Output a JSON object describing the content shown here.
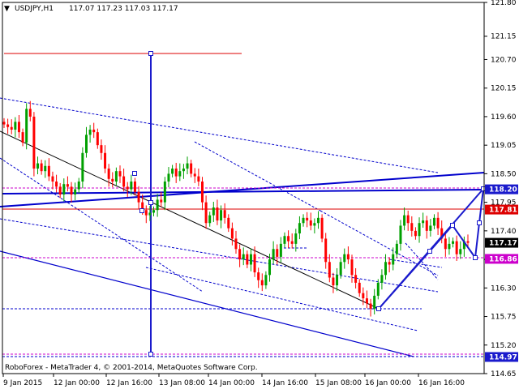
{
  "header": {
    "arrow": "▼",
    "symbol": "USDJPY,H1",
    "ohlc": "117.07 117.23 117.03 117.17"
  },
  "footer": {
    "copyright": "RoboForex - MetaTrader 4, © 2001-2014, MetaQuotes Software Corp."
  },
  "colors": {
    "bull": "#00a000",
    "bear": "#ff0000",
    "trendline": "#0000cc",
    "level_red": "#dd0000",
    "level_magenta": "#cc00cc",
    "projection": "#1a1acc",
    "axis": "#000000"
  },
  "chart_data": {
    "type": "candlestick",
    "symbol": "USDJPY",
    "timeframe": "H1",
    "ylim": [
      114.65,
      121.8
    ],
    "yticks": [
      "121.80",
      "121.15",
      "120.70",
      "120.15",
      "119.60",
      "119.05",
      "118.50",
      "117.95",
      "117.40",
      "116.85",
      "116.30",
      "115.75",
      "115.20",
      "114.65"
    ],
    "xticks": [
      "9 Jan 2015",
      "12 Jan 00:00",
      "12 Jan 16:00",
      "13 Jan 08:00",
      "14 Jan 00:00",
      "14 Jan 16:00",
      "15 Jan 08:00",
      "16 Jan 00:00",
      "16 Jan 16:00"
    ],
    "price_tags": [
      {
        "label": "118.20",
        "value": 118.2,
        "color": "#1a1acc"
      },
      {
        "label": "117.81",
        "value": 117.81,
        "color": "#dd0000"
      },
      {
        "label": "117.17",
        "value": 117.17,
        "color": "#000000"
      },
      {
        "label": "116.86",
        "value": 116.86,
        "color": "#cc00cc"
      },
      {
        "label": "114.97",
        "value": 114.97,
        "color": "#1a1acc"
      }
    ],
    "current_ohlc": {
      "open": 117.07,
      "high": 117.23,
      "low": 117.03,
      "close": 117.17
    },
    "closes": [
      119.45,
      119.4,
      119.35,
      119.5,
      119.3,
      119.1,
      119.75,
      119.6,
      118.6,
      118.7,
      118.55,
      118.65,
      118.45,
      118.35,
      118.25,
      118.1,
      118.3,
      118.25,
      118.1,
      118.2,
      118.35,
      118.9,
      119.25,
      119.35,
      119.3,
      119.05,
      118.9,
      118.6,
      118.4,
      118.35,
      118.55,
      118.45,
      118.25,
      118.2,
      118.35,
      118.15,
      117.95,
      117.8,
      117.7,
      117.75,
      117.8,
      118.0,
      117.95,
      118.35,
      118.5,
      118.6,
      118.45,
      118.55,
      118.6,
      118.7,
      118.5,
      118.45,
      118.35,
      117.95,
      117.55,
      117.7,
      117.85,
      117.6,
      117.8,
      117.65,
      117.45,
      117.25,
      117.05,
      116.85,
      116.95,
      116.75,
      116.95,
      116.6,
      116.45,
      116.35,
      116.55,
      116.85,
      117.05,
      116.9,
      117.15,
      117.3,
      117.2,
      117.15,
      117.35,
      117.55,
      117.65,
      117.6,
      117.5,
      117.55,
      117.65,
      117.25,
      116.8,
      116.5,
      116.35,
      116.55,
      116.8,
      116.95,
      116.85,
      116.55,
      116.4,
      116.2,
      116.1,
      116.0,
      115.9,
      116.15,
      116.4,
      116.55,
      116.8,
      116.75,
      116.95,
      117.15,
      117.5,
      117.7,
      117.55,
      117.4,
      117.3,
      117.55,
      117.6,
      117.4,
      117.5,
      117.65,
      117.45,
      117.25,
      117.05,
      117.15,
      117.2,
      116.95,
      117.05,
      117.2,
      117.17
    ]
  }
}
